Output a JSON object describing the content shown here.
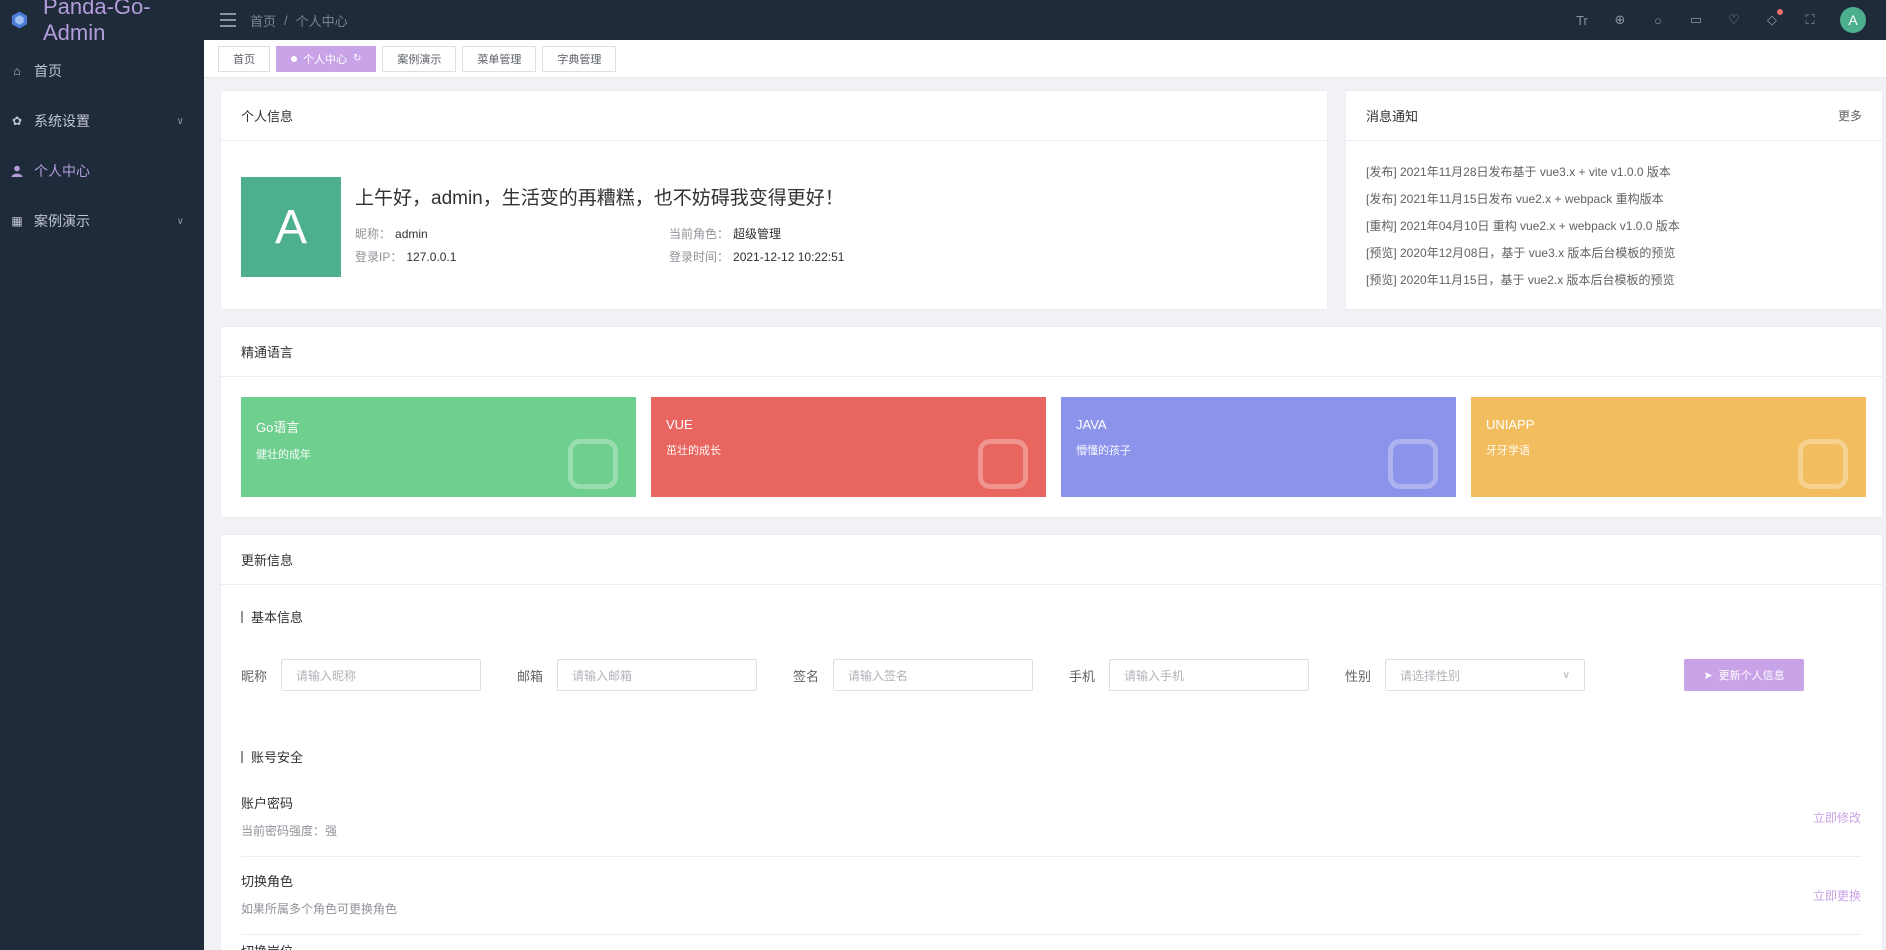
{
  "app": {
    "title": "Panda-Go-Admin"
  },
  "breadcrumb": {
    "home": "首页",
    "sep": "/",
    "current": "个人中心"
  },
  "header": {
    "avatar_letter": "A"
  },
  "sidebar": {
    "items": [
      {
        "label": "首页",
        "icon": "home-icon"
      },
      {
        "label": "系统设置",
        "icon": "gear-icon"
      },
      {
        "label": "个人中心",
        "icon": "user-icon"
      },
      {
        "label": "案例演示",
        "icon": "grid-icon"
      }
    ]
  },
  "tags": [
    "首页",
    "个人中心",
    "案例演示",
    "菜单管理",
    "字典管理"
  ],
  "profile": {
    "header": "个人信息",
    "avatar_letter": "A",
    "greeting": "上午好，admin，生活变的再糟糕，也不妨碍我变得更好！",
    "nickname_label": "昵称：",
    "nickname": "admin",
    "role_label": "当前角色：",
    "role": "超级管理",
    "ip_label": "登录IP：",
    "ip": "127.0.0.1",
    "time_label": "登录时间：",
    "time": "2021-12-12 10:22:51"
  },
  "notice": {
    "header": "消息通知",
    "more": "更多",
    "items": [
      "[发布] 2021年11月28日发布基于 vue3.x + vite v1.0.0 版本",
      "[发布] 2021年11月15日发布 vue2.x + webpack 重构版本",
      "[重构] 2021年04月10日 重构 vue2.x + webpack v1.0.0 版本",
      "[预览] 2020年12月08日，基于 vue3.x 版本后台模板的预览",
      "[预览] 2020年11月15日，基于 vue2.x 版本后台模板的预览"
    ]
  },
  "languages": {
    "header": "精通语言",
    "cards": [
      {
        "title": "Go语言",
        "sub": "健壮的成年",
        "color": "#6fcf8f"
      },
      {
        "title": "VUE",
        "sub": "茁壮的成长",
        "color": "#e8665f"
      },
      {
        "title": "JAVA",
        "sub": "懵懂的孩子",
        "color": "#8b93ea"
      },
      {
        "title": "UNIAPP",
        "sub": "牙牙学语",
        "color": "#f2bd5f"
      }
    ]
  },
  "update": {
    "header": "更新信息",
    "basic_title": "基本信息",
    "fields": [
      {
        "label": "昵称",
        "placeholder": "请输入昵称"
      },
      {
        "label": "邮箱",
        "placeholder": "请输入邮箱"
      },
      {
        "label": "签名",
        "placeholder": "请输入签名"
      },
      {
        "label": "手机",
        "placeholder": "请输入手机"
      },
      {
        "label": "性别",
        "placeholder": "请选择性别"
      }
    ],
    "submit_label": "更新个人信息",
    "security_title": "账号安全",
    "security": [
      {
        "title": "账户密码",
        "desc": "当前密码强度：强",
        "action": "立即修改"
      },
      {
        "title": "切换角色",
        "desc": "如果所属多个角色可更换角色",
        "action": "立即更换"
      },
      {
        "title": "切换岗位"
      }
    ]
  },
  "colors": {
    "sidebar_bg": "#1f2a3a",
    "accent": "#c9a3e8",
    "avatar": "#4caf8e"
  }
}
